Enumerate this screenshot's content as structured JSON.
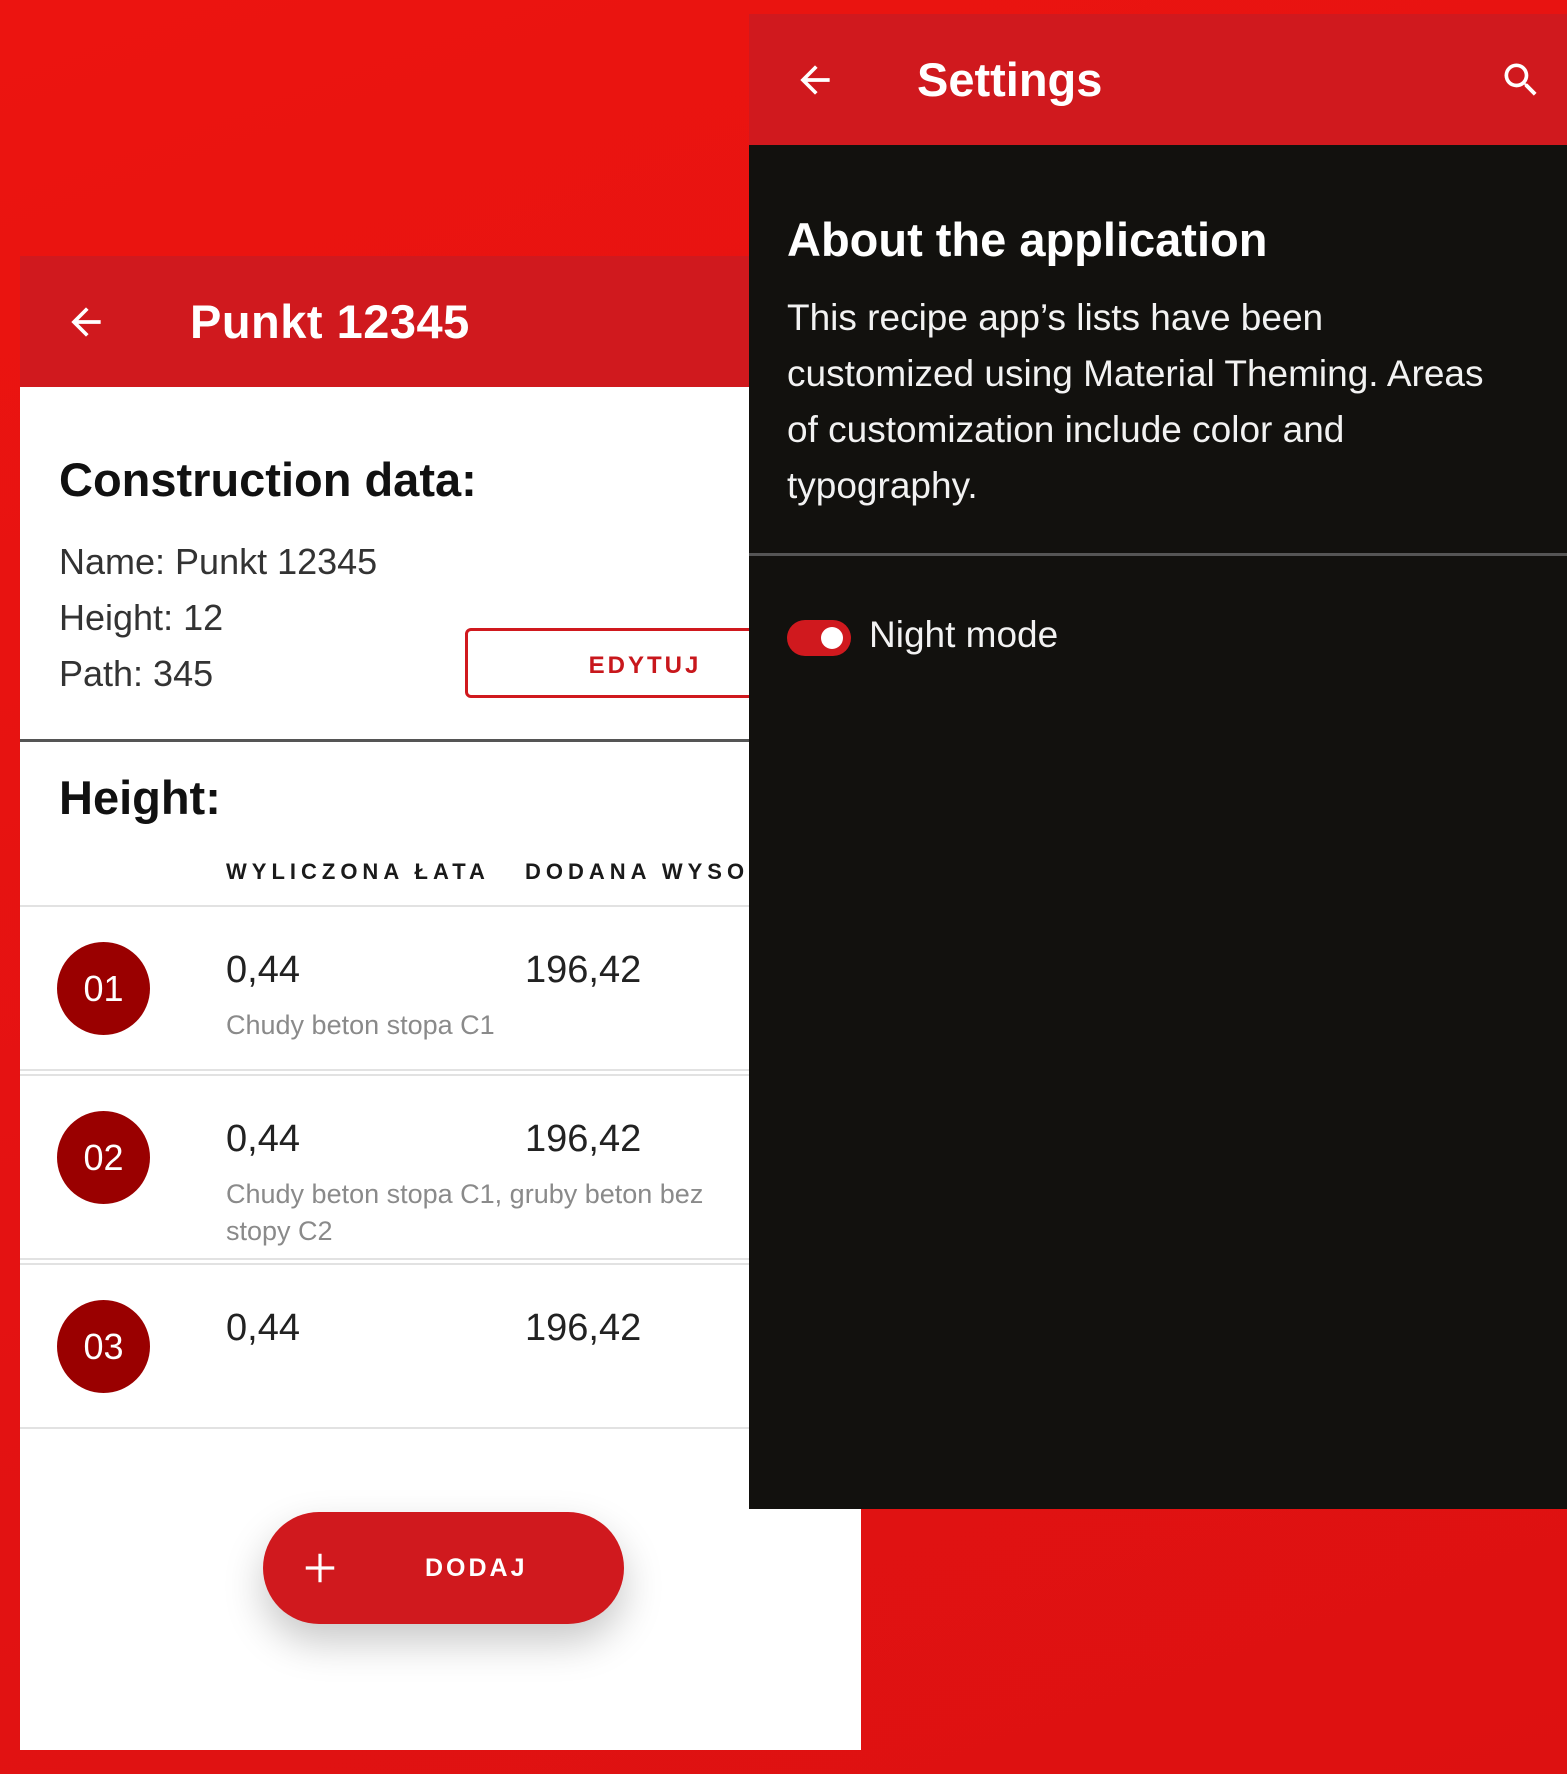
{
  "colors": {
    "accent": "#d0191e",
    "background": "#e61212",
    "badge": "#9a0000",
    "dark_surface": "#12110e"
  },
  "construction_screen": {
    "title": "Punkt 12345",
    "back_icon": "arrow-left-icon",
    "construction_heading": "Construction data:",
    "info": {
      "name": "Name: Punkt 12345",
      "height": "Height: 12",
      "path": "Path: 345"
    },
    "edit_label": "EDYTUJ",
    "height_heading": "Height:",
    "columns": [
      "WYLICZONA ŁATA",
      "DODANA WYSO"
    ],
    "rows": [
      {
        "badge": "01",
        "value1": "0,44",
        "value2": "196,42",
        "description": "Chudy beton stopa C1"
      },
      {
        "badge": "02",
        "value1": "0,44",
        "value2": "196,42",
        "description": "Chudy beton stopa C1,  gruby beton bez\nstopy C2"
      },
      {
        "badge": "03",
        "value1": "0,44",
        "value2": "196,42",
        "description": ""
      }
    ],
    "fab": {
      "icon": "plus-icon",
      "label": "DODAJ"
    }
  },
  "settings_screen": {
    "title": "Settings",
    "back_icon": "arrow-left-icon",
    "search_icon": "search-icon",
    "about_heading": "About the application",
    "about_text": "This recipe app’s lists have been customized using Material Theming. Areas of customization include color and typography.",
    "night_mode_label": "Night mode",
    "night_mode_on": true
  }
}
